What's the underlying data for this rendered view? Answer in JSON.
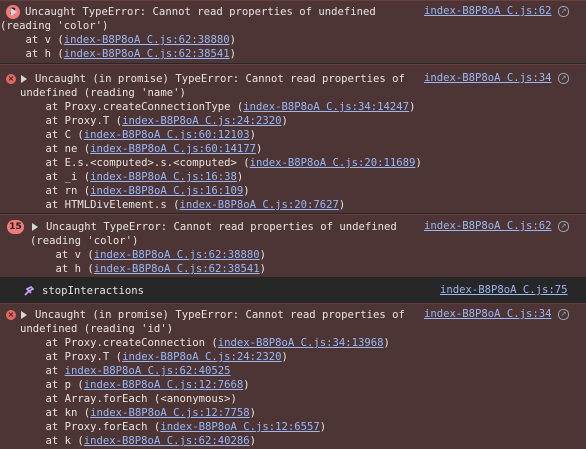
{
  "entries": [
    {
      "kind": "error",
      "count": "3",
      "source": "index-B8P8oA C.js:62",
      "lines": [
        [
          {
            "t": "Uncaught TypeError: Cannot read properties of undefined"
          }
        ],
        [
          {
            "t": "(reading 'color')"
          }
        ],
        [
          {
            "t": "    at v ("
          },
          {
            "t": "index-B8P8oA C.js:62:38880",
            "link": true
          },
          {
            "t": ")"
          }
        ],
        [
          {
            "t": "    at h ("
          },
          {
            "t": "index-B8P8oA C.js:62:38541",
            "link": true
          },
          {
            "t": ")"
          }
        ]
      ]
    },
    {
      "kind": "error",
      "count": "",
      "source": "index-B8P8oA C.js:34",
      "lines": [
        [
          {
            "t": "Uncaught (in promise) TypeError: Cannot read properties of"
          }
        ],
        [
          {
            "t": "undefined (reading 'name')"
          }
        ],
        [
          {
            "t": "    at Proxy.createConnectionType ("
          },
          {
            "t": "index-B8P8oA C.js:34:14247",
            "link": true
          },
          {
            "t": ")"
          }
        ],
        [
          {
            "t": "    at Proxy.T ("
          },
          {
            "t": "index-B8P8oA C.js:24:2320",
            "link": true
          },
          {
            "t": ")"
          }
        ],
        [
          {
            "t": "    at C ("
          },
          {
            "t": "index-B8P8oA C.js:60:12103",
            "link": true
          },
          {
            "t": ")"
          }
        ],
        [
          {
            "t": "    at ne ("
          },
          {
            "t": "index-B8P8oA C.js:60:14177",
            "link": true
          },
          {
            "t": ")"
          }
        ],
        [
          {
            "t": "    at E.s.<computed>.s.<computed> ("
          },
          {
            "t": "index-B8P8oA C.js:20:11689",
            "link": true
          },
          {
            "t": ")"
          }
        ],
        [
          {
            "t": "    at _i ("
          },
          {
            "t": "index-B8P8oA C.js:16:38",
            "link": true
          },
          {
            "t": ")"
          }
        ],
        [
          {
            "t": "    at rn ("
          },
          {
            "t": "index-B8P8oA C.js:16:109",
            "link": true
          },
          {
            "t": ")"
          }
        ],
        [
          {
            "t": "    at HTMLDivElement.s ("
          },
          {
            "t": "index-B8P8oA C.js:20:7627",
            "link": true
          },
          {
            "t": ")"
          }
        ]
      ]
    },
    {
      "kind": "error",
      "count": "15",
      "source": "index-B8P8oA C.js:62",
      "lines": [
        [
          {
            "t": "Uncaught TypeError: Cannot read properties of undefined"
          }
        ],
        [
          {
            "t": "(reading 'color')"
          }
        ],
        [
          {
            "t": "    at v ("
          },
          {
            "t": "index-B8P8oA C.js:62:38880",
            "link": true
          },
          {
            "t": ")"
          }
        ],
        [
          {
            "t": "    at h ("
          },
          {
            "t": "index-B8P8oA C.js:62:38541",
            "link": true
          },
          {
            "t": ")"
          }
        ]
      ]
    },
    {
      "kind": "log",
      "count": "",
      "source": "index-B8P8oA C.js:75",
      "lines": [
        [
          {
            "t": "stopInteractions"
          }
        ]
      ]
    },
    {
      "kind": "error",
      "count": "",
      "source": "index-B8P8oA C.js:34",
      "lines": [
        [
          {
            "t": "Uncaught (in promise) TypeError: Cannot read properties of"
          }
        ],
        [
          {
            "t": "undefined (reading 'id')"
          }
        ],
        [
          {
            "t": "    at Proxy.createConnection ("
          },
          {
            "t": "index-B8P8oA C.js:34:13968",
            "link": true
          },
          {
            "t": ")"
          }
        ],
        [
          {
            "t": "    at Proxy.T ("
          },
          {
            "t": "index-B8P8oA C.js:24:2320",
            "link": true
          },
          {
            "t": ")"
          }
        ],
        [
          {
            "t": "    at "
          },
          {
            "t": "index-B8P8oA C.js:62:40525",
            "link": true
          }
        ],
        [
          {
            "t": "    at p ("
          },
          {
            "t": "index-B8P8oA C.js:12:7668",
            "link": true
          },
          {
            "t": ")"
          }
        ],
        [
          {
            "t": "    at Array.forEach (<anonymous>)"
          }
        ],
        [
          {
            "t": "    at kn ("
          },
          {
            "t": "index-B8P8oA C.js:12:7758",
            "link": true
          },
          {
            "t": ")"
          }
        ],
        [
          {
            "t": "    at Proxy.forEach ("
          },
          {
            "t": "index-B8P8oA C.js:12:6557",
            "link": true
          },
          {
            "t": ")"
          }
        ],
        [
          {
            "t": "    at k ("
          },
          {
            "t": "index-B8P8oA C.js:62:40286",
            "link": true
          },
          {
            "t": ")"
          }
        ]
      ]
    }
  ],
  "icons": {
    "error_count_badge": "count-badge",
    "error_icon": "error-x-icon",
    "expand": "expand-triangle-icon",
    "source_map": "source-map-icon",
    "function": "function-icon"
  }
}
